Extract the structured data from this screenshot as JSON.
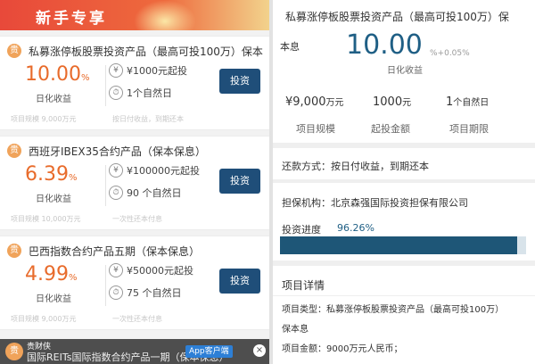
{
  "banner": {
    "title": "新手专享"
  },
  "products": [
    {
      "title": "私募涨停板股票投资产品（最高可投100万）保本",
      "rate": "10.00",
      "rate_unit": "%",
      "rate_label": "日化收益",
      "line1_icon": "¥",
      "line1_text": "¥1000元起投",
      "line2_icon": "⏱",
      "line2_text": "1个自然日",
      "invest_label": "投资",
      "faint_left": "项目规模  9,000万元",
      "faint_right": "按日付收益，到期还本"
    },
    {
      "title": "西班牙IBEX35合约产品（保本保息）",
      "rate": "6.39",
      "rate_unit": "%",
      "rate_label": "日化收益",
      "line1_icon": "¥",
      "line1_text": "¥100000元起投",
      "line2_icon": "⏱",
      "line2_text": "90 个自然日",
      "invest_label": "投资",
      "faint_left": "项目规模  10,000万元",
      "faint_right": "一次性还本付息"
    },
    {
      "title": "巴西指数合约产品五期（保本保息）",
      "rate": "4.99",
      "rate_unit": "%",
      "rate_label": "日化收益",
      "line1_icon": "¥",
      "line1_text": "¥50000元起投",
      "line2_icon": "⏱",
      "line2_text": "75 个自然日",
      "invest_label": "投资",
      "faint_left": "项目规模  9,000万元",
      "faint_right": "一次性还本付息"
    }
  ],
  "footer": {
    "brand": "贵财侠",
    "text": "国际REITs国际指数合约产品一期（保本保息）",
    "app_label": "App客户端",
    "close": "×"
  },
  "detail": {
    "title": "私募涨停板股票投资产品（最高可投100万）保",
    "basis": "本息",
    "rate": "10.00",
    "rate_extra": "%+0.05%",
    "rate_label": "日化收益",
    "stats": [
      {
        "value": "¥9,000",
        "unit": "万元",
        "label": "项目规模"
      },
      {
        "value": "1000",
        "unit": "元",
        "label": "起投金额"
      },
      {
        "value": "1",
        "unit": "个自然日",
        "label": "项目期限"
      }
    ],
    "repay": "还款方式：按日付收益，到期还本",
    "guarantor": "担保机构：北京森强国际投资担保有限公司",
    "progress_label": "投资进度",
    "progress_value": "96.26%",
    "progress_fraction": 0.9626,
    "detail_title": "项目详情",
    "type_line": "项目类型：私募涨停板股票投资产品（最高可投100万）",
    "type_line2": "保本息",
    "amount_line": "项目金额：9000万元人民币；"
  },
  "colors": {
    "accent": "#1f4e79",
    "rate": "#e86b2b",
    "banner": "#e8493a"
  }
}
